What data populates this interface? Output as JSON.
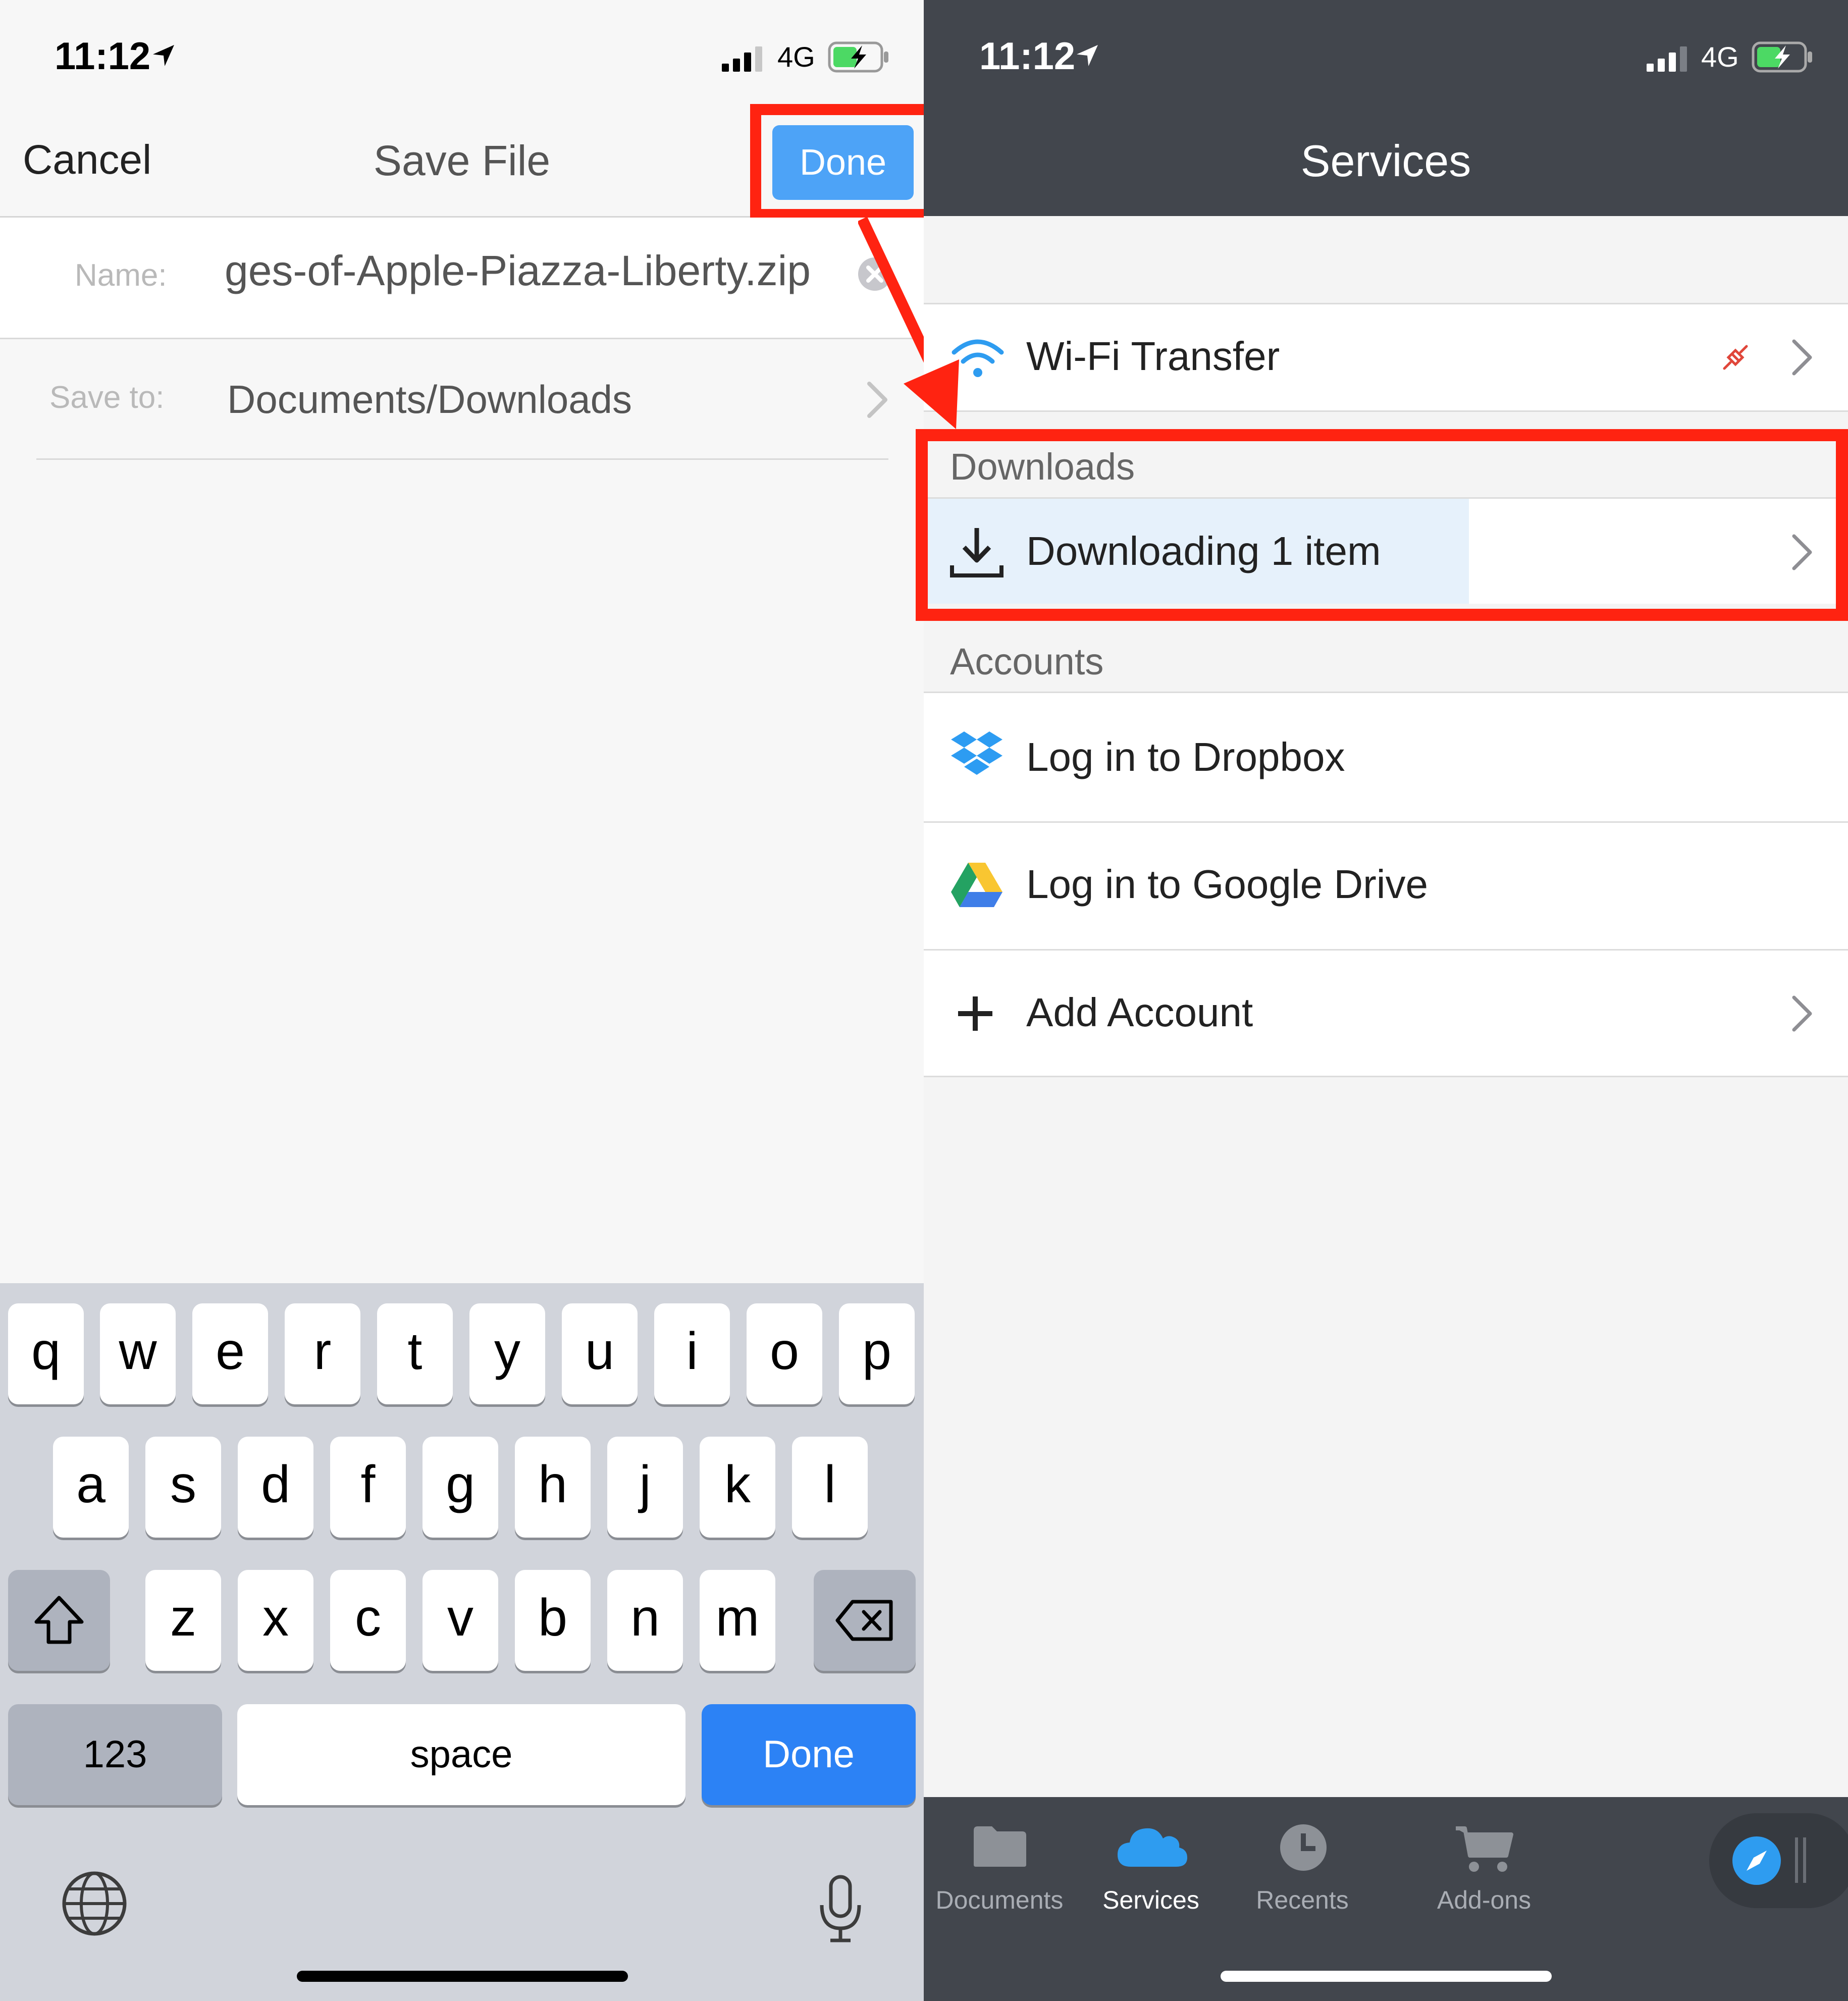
{
  "left": {
    "status": {
      "time": "11:12",
      "network": "4G"
    },
    "nav": {
      "cancel": "Cancel",
      "title": "Save File",
      "done": "Done"
    },
    "form": {
      "name_label": "Name:",
      "name_value": "ges-of-Apple-Piazza-Liberty.zip",
      "saveto_label": "Save to:",
      "saveto_value": "Documents/Downloads"
    },
    "keyboard": {
      "row1": [
        "q",
        "w",
        "e",
        "r",
        "t",
        "y",
        "u",
        "i",
        "o",
        "p"
      ],
      "row2": [
        "a",
        "s",
        "d",
        "f",
        "g",
        "h",
        "j",
        "k",
        "l"
      ],
      "row3": [
        "z",
        "x",
        "c",
        "v",
        "b",
        "n",
        "m"
      ],
      "numbers_key": "123",
      "space_key": "space",
      "done_key": "Done"
    }
  },
  "right": {
    "status": {
      "time": "11:12",
      "network": "4G"
    },
    "nav": {
      "title": "Services"
    },
    "wifi": {
      "label": "Wi-Fi Transfer"
    },
    "downloads": {
      "section": "Downloads",
      "label": "Downloading 1 item",
      "progress": 0.59
    },
    "accounts": {
      "section": "Accounts",
      "dropbox": "Log in to Dropbox",
      "gdrive": "Log in to Google Drive",
      "add": "Add Account"
    },
    "tabs": [
      "Documents",
      "Services",
      "Recents",
      "Add-ons"
    ],
    "active_tab": "Services"
  },
  "colors": {
    "highlight": "#ff2311",
    "accent": "#2c82f5",
    "navDark": "#42464d"
  }
}
